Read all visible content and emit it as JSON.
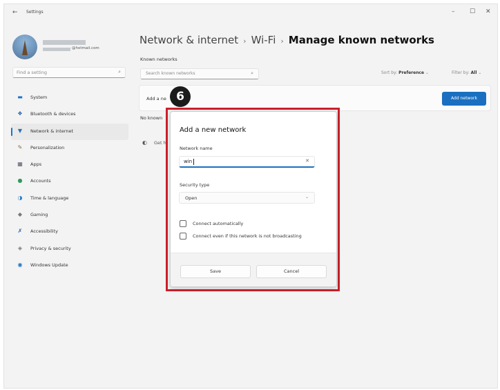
{
  "window": {
    "title": "Settings",
    "controls": {
      "minimize": "–",
      "maximize": "☐",
      "close": "✕"
    }
  },
  "user": {
    "email_suffix": "@hotmail.com"
  },
  "sidebar": {
    "search_placeholder": "Find a setting",
    "items": [
      {
        "label": "System",
        "icon": "monitor-icon",
        "glyph": "▬",
        "color": "#1a73c7"
      },
      {
        "label": "Bluetooth & devices",
        "icon": "bluetooth-icon",
        "glyph": "❖",
        "color": "#1a5fa8"
      },
      {
        "label": "Network & internet",
        "icon": "wifi-icon",
        "glyph": "▼",
        "color": "#2b6fb3",
        "selected": true
      },
      {
        "label": "Personalization",
        "icon": "brush-icon",
        "glyph": "✎",
        "color": "#8a6a3a"
      },
      {
        "label": "Apps",
        "icon": "apps-icon",
        "glyph": "▦",
        "color": "#555a66"
      },
      {
        "label": "Accounts",
        "icon": "person-icon",
        "glyph": "●",
        "color": "#2f9a5a"
      },
      {
        "label": "Time & language",
        "icon": "globe-icon",
        "glyph": "◑",
        "color": "#2a7fc6"
      },
      {
        "label": "Gaming",
        "icon": "controller-icon",
        "glyph": "◆",
        "color": "#777"
      },
      {
        "label": "Accessibility",
        "icon": "accessibility-icon",
        "glyph": "✗",
        "color": "#1e5fa3"
      },
      {
        "label": "Privacy & security",
        "icon": "shield-icon",
        "glyph": "◈",
        "color": "#777"
      },
      {
        "label": "Windows Update",
        "icon": "update-icon",
        "glyph": "◉",
        "color": "#1a73c7"
      }
    ]
  },
  "main": {
    "breadcrumb": [
      "Network & internet",
      "Wi-Fi",
      "Manage known networks"
    ],
    "breadcrumb_sep": "›",
    "known_networks_label": "Known networks",
    "search_placeholder": "Search known networks",
    "sort_by_label": "Sort by:",
    "sort_by_value": "Preference",
    "filter_by_label": "Filter by:",
    "filter_by_value": "All",
    "add_network_label": "Add a ne",
    "add_network_button": "Add network",
    "no_known_text": "No known",
    "get_help_text": "Get h"
  },
  "dialog": {
    "title": "Add a new network",
    "network_name_label": "Network name",
    "network_name_value": "win",
    "security_type_label": "Security type",
    "security_type_value": "Open",
    "connect_auto_label": "Connect automatically",
    "connect_hidden_label": "Connect even if this network is not broadcasting",
    "save_label": "Save",
    "cancel_label": "Cancel"
  },
  "annotation": {
    "step_number": "6",
    "highlight_color": "#cc1f2a"
  }
}
